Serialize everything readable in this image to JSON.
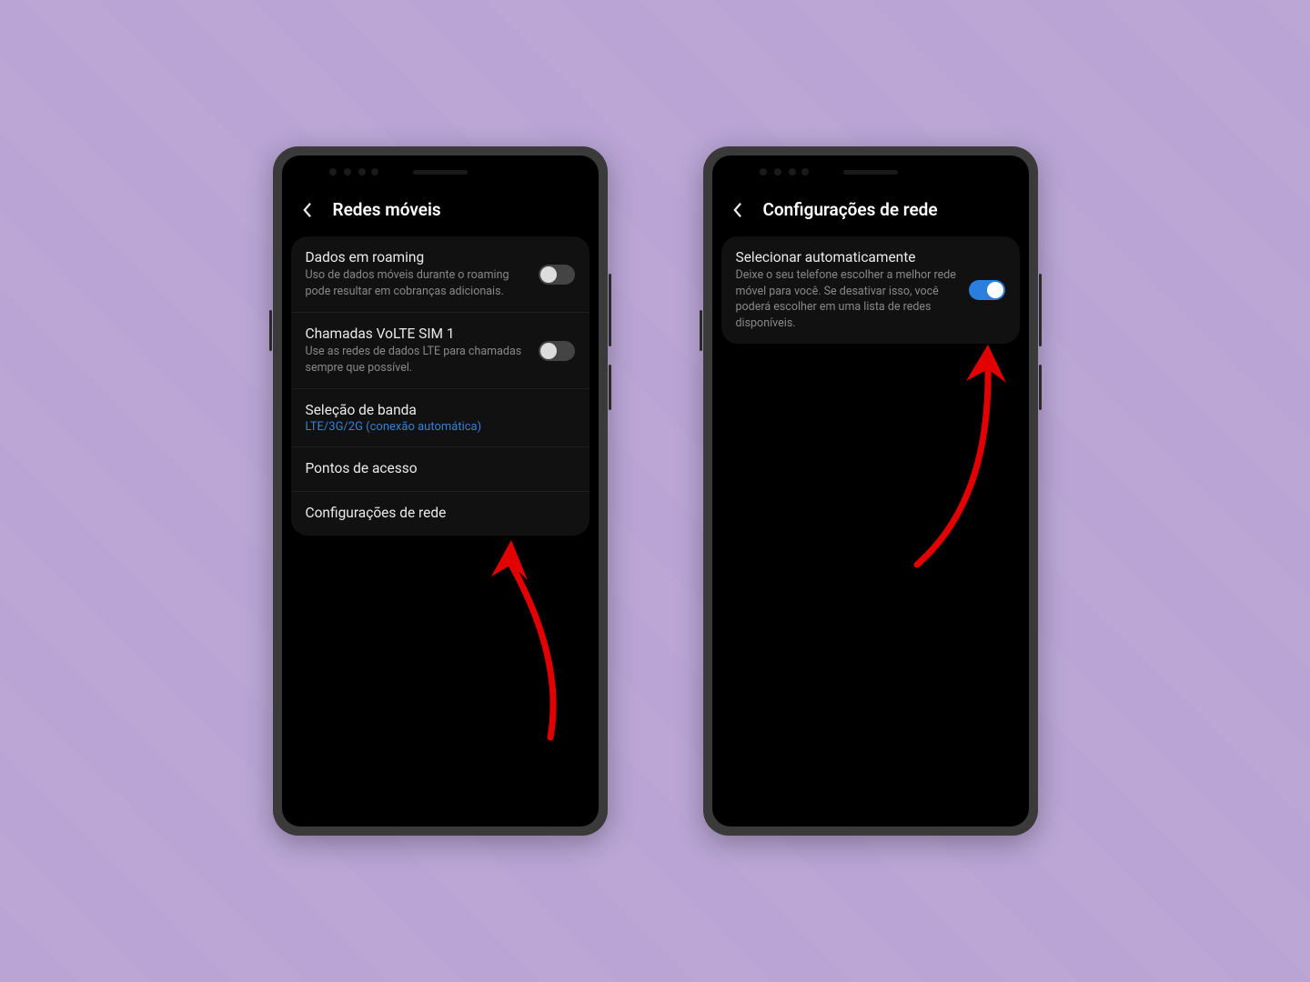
{
  "phone1": {
    "header": {
      "title": "Redes móveis"
    },
    "settings": {
      "roaming": {
        "title": "Dados em roaming",
        "subtitle": "Uso de dados móveis durante o roaming pode resultar em cobranças adicionais.",
        "enabled": false
      },
      "volte": {
        "title": "Chamadas VoLTE SIM 1",
        "subtitle": "Use as redes de dados LTE para chamadas sempre que possível.",
        "enabled": false
      },
      "band": {
        "title": "Seleção de banda",
        "value": "LTE/3G/2G (conexão automática)"
      },
      "apn": {
        "title": "Pontos de acesso"
      },
      "network_config": {
        "title": "Configurações de rede"
      }
    }
  },
  "phone2": {
    "header": {
      "title": "Configurações de rede"
    },
    "settings": {
      "auto_select": {
        "title": "Selecionar automaticamente",
        "subtitle": "Deixe o seu telefone escolher a melhor rede móvel para você. Se desativar isso, você poderá escolher em uma lista de redes disponíveis.",
        "enabled": true
      }
    }
  }
}
